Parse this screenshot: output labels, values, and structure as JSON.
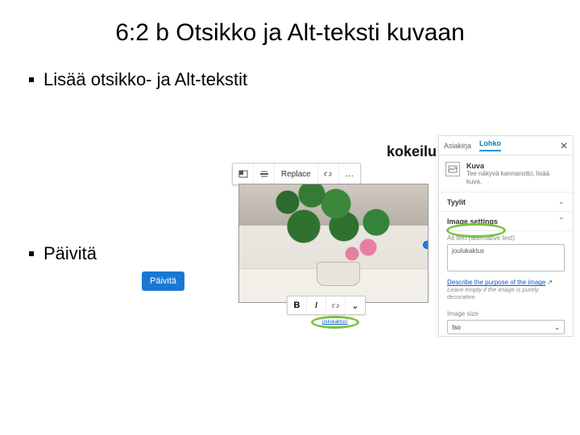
{
  "title": "6:2 b Otsikko ja Alt-teksti kuvaan",
  "bullets": {
    "b1": "Lisää otsikko- ja Alt-tekstit",
    "b2": "Päivitä"
  },
  "update_button": "Päivitä",
  "editor": {
    "heading": "kokeilu",
    "toolbar_top": {
      "replace": "Replace",
      "more": "…"
    },
    "toolbar_bottom": {
      "bold": "B",
      "italic": "I",
      "chevron": "⌄"
    },
    "caption": "joulukaktus!"
  },
  "panel": {
    "tabs": {
      "doc": "Asiakirja",
      "block": "Lohko"
    },
    "close": "✕",
    "block": {
      "name": "Kuva",
      "desc": "Tee näkyvä kannanotto, lisää kuva."
    },
    "styles_heading": "Tyylit",
    "settings_heading": "Image settings",
    "alt_label": "Alt text (alternative text)",
    "alt_value": "joulukaktus",
    "purpose_link": "Describe the purpose of the image",
    "ext_icon": "↗",
    "hint": "Leave empty if the image is purely decorative.",
    "size_label": "Image size",
    "size_value": "Iso"
  }
}
